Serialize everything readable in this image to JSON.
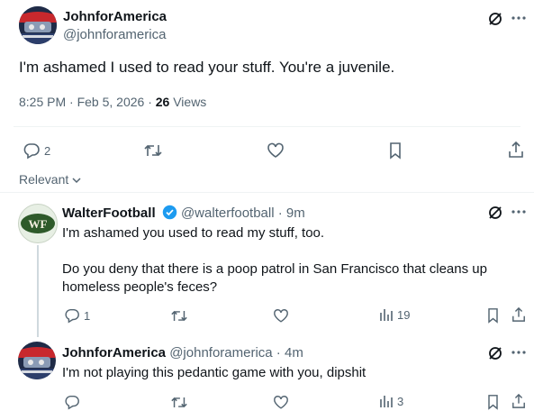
{
  "main_tweet": {
    "name": "JohnforAmerica",
    "handle": "@johnforamerica",
    "text": "I'm ashamed I used to read your stuff. You're a juvenile.",
    "time": "8:25 PM · Feb 5, 2026 · ",
    "views_count": "26",
    "views_label": " Views",
    "reply_count": "2"
  },
  "relevant_label": "Relevant",
  "replies": [
    {
      "name": "WalterFootball",
      "handle": "@walterfootball · 9m",
      "avatar_text": "WF",
      "line1": "I'm ashamed you used to read my stuff, too.",
      "line2": "Do you deny that there is a poop patrol in San Francisco that cleans up",
      "line3": "homeless people's feces?",
      "reply_count": "1",
      "views": "19"
    },
    {
      "name": "JohnforAmerica",
      "handle": "@johnforamerica · 4m",
      "line1": "I'm not playing this pedantic game with you, dipshit",
      "views": "3"
    }
  ],
  "colors": {
    "text": "#0f1419",
    "muted": "#536471",
    "verified": "#1d9bf0",
    "divider": "#eff3f4"
  }
}
